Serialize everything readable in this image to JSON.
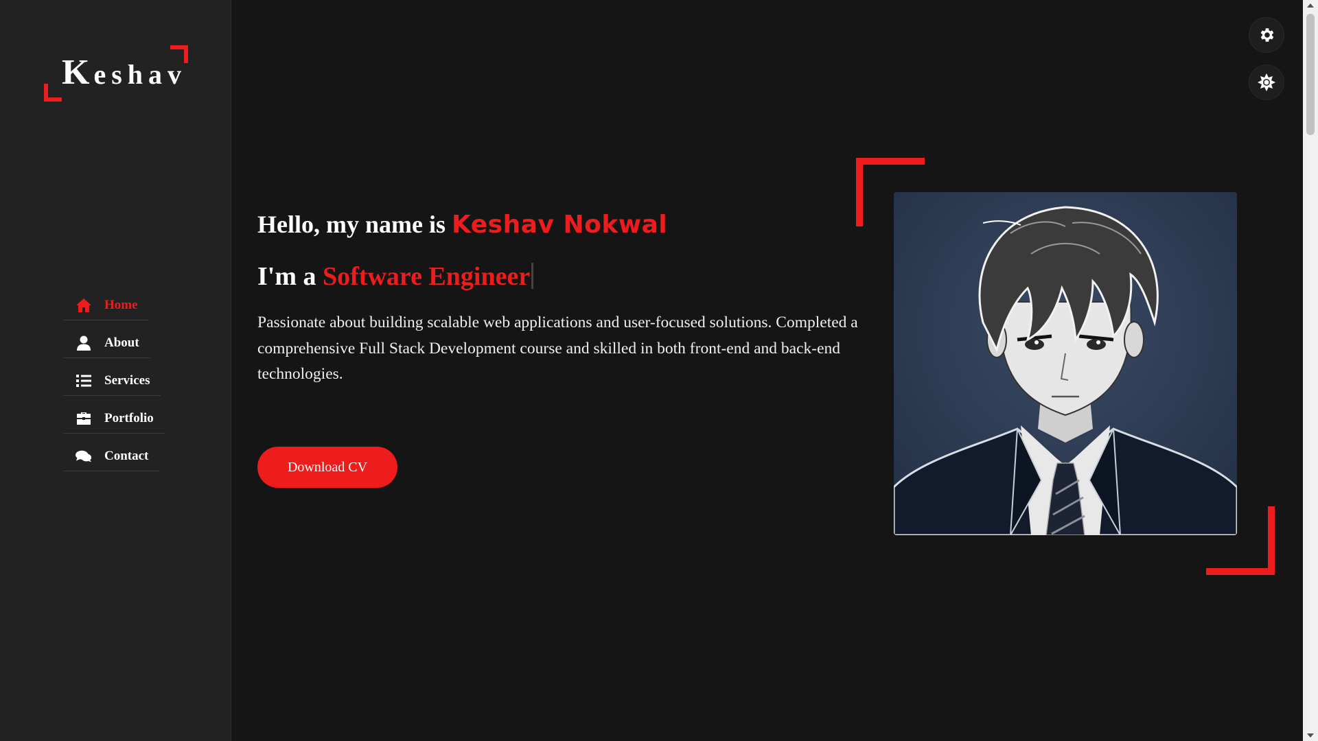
{
  "brand": {
    "logo_initial": "K",
    "logo_rest": "eshav",
    "accent_color": "#ee1c1c"
  },
  "nav": {
    "items": [
      {
        "label": "Home",
        "icon": "home-icon",
        "active": true
      },
      {
        "label": "About",
        "icon": "user-icon",
        "active": false
      },
      {
        "label": "Services",
        "icon": "list-icon",
        "active": false
      },
      {
        "label": "Portfolio",
        "icon": "briefcase-icon",
        "active": false
      },
      {
        "label": "Contact",
        "icon": "comments-icon",
        "active": false
      }
    ]
  },
  "hero": {
    "greeting": "Hello, my name is ",
    "name": "Keshav Nokwal",
    "role_prefix": "I'm a ",
    "role": "Software Engineer",
    "description": "Passionate about building scalable web applications and user-focused solutions. Completed a comprehensive Full Stack Development course and skilled in both front-end and back-end technologies.",
    "cta_label": "Download CV"
  },
  "controls": {
    "settings_icon": "gear-icon",
    "theme_icon": "sun-icon"
  }
}
